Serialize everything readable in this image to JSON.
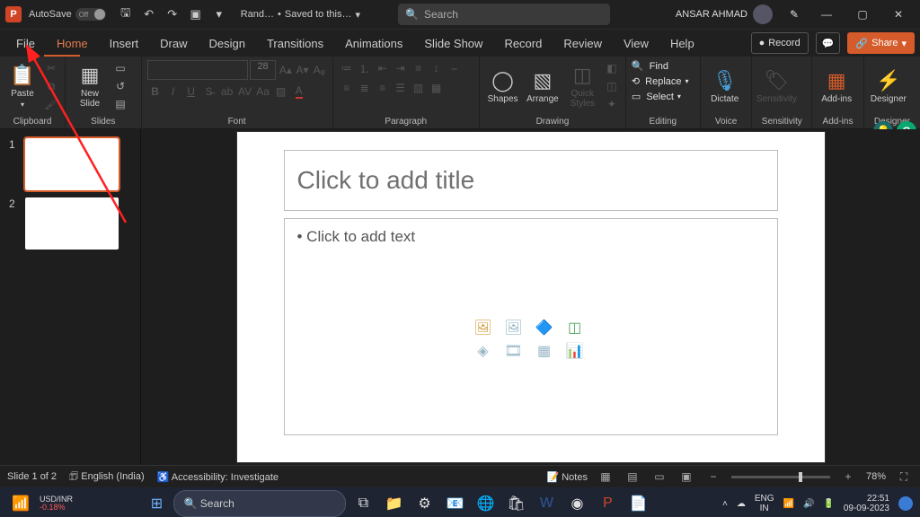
{
  "titlebar": {
    "app_letter": "P",
    "autosave_label": "AutoSave",
    "autosave_state": "Off",
    "file_name": "Rand…",
    "save_status": "Saved to this…",
    "search_placeholder": "Search",
    "user_name": "ANSAR AHMAD"
  },
  "tabs": {
    "file": "File",
    "home": "Home",
    "insert": "Insert",
    "draw": "Draw",
    "design": "Design",
    "transitions": "Transitions",
    "animations": "Animations",
    "slideshow": "Slide Show",
    "record": "Record",
    "review": "Review",
    "view": "View",
    "help": "Help",
    "record_btn": "Record",
    "share_btn": "Share"
  },
  "ribbon": {
    "clipboard": {
      "paste": "Paste",
      "label": "Clipboard"
    },
    "slides": {
      "new_slide": "New\nSlide",
      "label": "Slides"
    },
    "font": {
      "label": "Font",
      "size": "28"
    },
    "paragraph": {
      "label": "Paragraph"
    },
    "drawing": {
      "shapes": "Shapes",
      "arrange": "Arrange",
      "quick": "Quick\nStyles",
      "label": "Drawing"
    },
    "editing": {
      "find": "Find",
      "replace": "Replace",
      "select": "Select",
      "label": "Editing"
    },
    "voice": {
      "dictate": "Dictate",
      "label": "Voice"
    },
    "sensitivity": {
      "btn": "Sensitivity",
      "label": "Sensitivity"
    },
    "addins": {
      "btn": "Add-ins",
      "label": "Add-ins"
    },
    "designer": {
      "btn": "Designer",
      "label": "Designer"
    }
  },
  "thumbs": {
    "n1": "1",
    "n2": "2"
  },
  "slide": {
    "title_placeholder": "Click to add title",
    "body_placeholder": "• Click to add text"
  },
  "status": {
    "slide_count": "Slide 1 of 2",
    "language": "English (India)",
    "accessibility": "Accessibility: Investigate",
    "notes": "Notes",
    "zoom": "78%"
  },
  "taskbar": {
    "widget_pair": "USD/INR",
    "widget_change": "-0.18%",
    "search": "Search",
    "lang1": "ENG",
    "lang2": "IN",
    "time": "22:51",
    "date": "09-09-2023"
  }
}
